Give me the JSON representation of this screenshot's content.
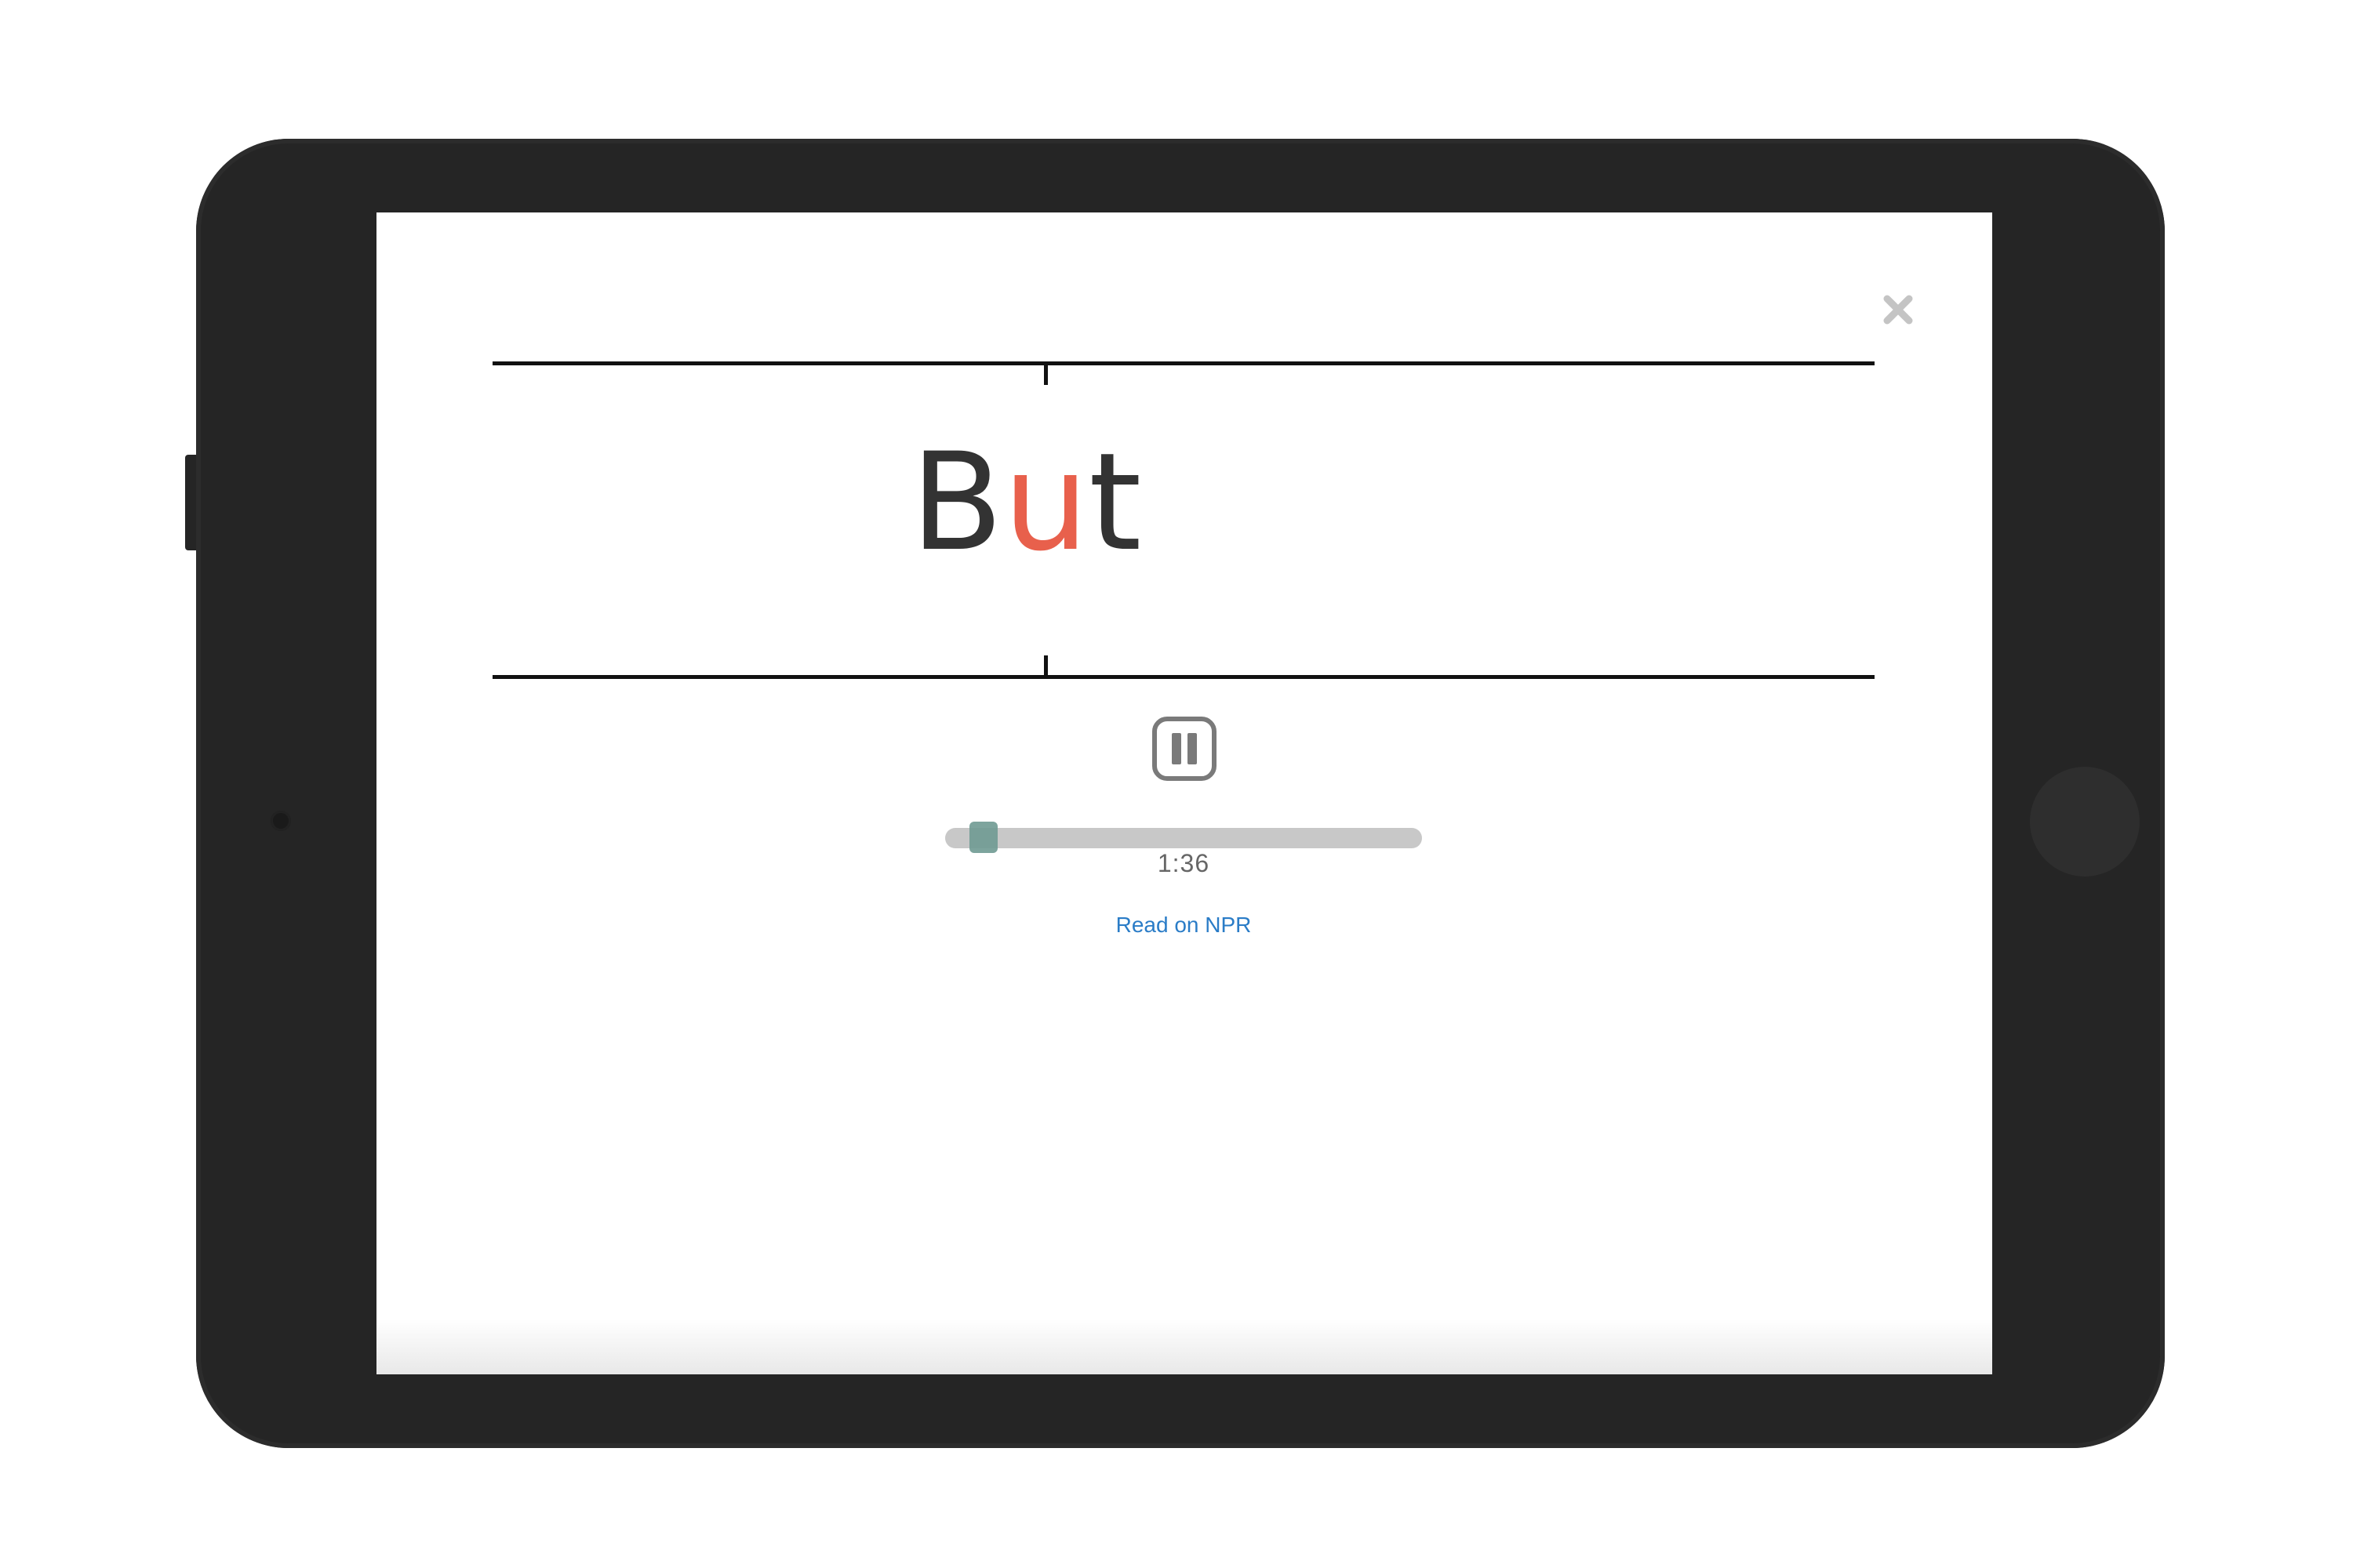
{
  "reader": {
    "word": {
      "before": "B",
      "focus": "u",
      "after": "t"
    },
    "colors": {
      "text": "#333333",
      "focus_letter": "#e8604c",
      "rules": "#111111"
    }
  },
  "controls": {
    "close_icon": "close-icon",
    "play_state_icon": "pause-icon",
    "progress_fraction": 0.08,
    "time": "1:36",
    "progress_colors": {
      "track": "#c8c8c8",
      "knob": "#6f9a92"
    }
  },
  "links": {
    "read_on_npr": "Read on NPR",
    "link_color": "#2a7cc7"
  },
  "device": {
    "body_color": "#252525"
  }
}
